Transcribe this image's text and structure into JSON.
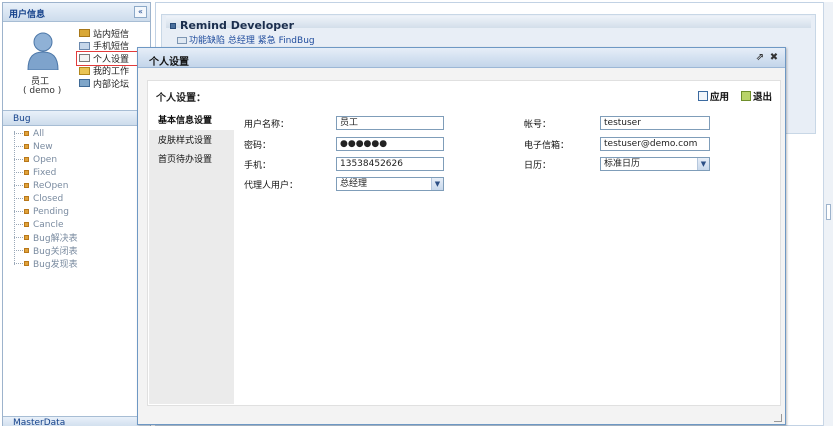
{
  "sidebar": {
    "title": "用户信息",
    "collapse_symbol": "«",
    "user_name": "员工",
    "user_role": "( demo )",
    "menu": [
      {
        "label": "站内短信",
        "icon": "mail-icon"
      },
      {
        "label": "手机短信",
        "icon": "phone-icon"
      },
      {
        "label": "个人设置",
        "icon": "edit-icon"
      },
      {
        "label": "我的工作",
        "icon": "folder-icon"
      },
      {
        "label": "内部论坛",
        "icon": "home-icon"
      }
    ],
    "bug_title": "Bug",
    "bug_items": [
      "All",
      "New",
      "Open",
      "Fixed",
      "ReOpen",
      "Closed",
      "Pending",
      "Cancle",
      "Bug解决表",
      "Bug关闭表",
      "Bug发现表"
    ],
    "masterdata_title": "MasterData"
  },
  "remind": {
    "title": "Remind Developer",
    "line": "功能缺陷 总经理 紧急 FindBug"
  },
  "dialog": {
    "title": "个人设置",
    "pin_symbol": "⇗",
    "close_symbol": "✖",
    "header": "个人设置：",
    "apply_label": "应用",
    "exit_label": "退出",
    "tabs": [
      "基本信息设置",
      "皮肤样式设置",
      "首页待办设置"
    ],
    "form": {
      "username_label": "用户名称：",
      "username_value": "员工",
      "password_label": "密码：",
      "password_value": "●●●●●●",
      "mobile_label": "手机：",
      "mobile_value": "13538452626",
      "proxy_label": "代理人用户：",
      "proxy_value": "总经理",
      "account_label": "帐号：",
      "account_value": "testuser",
      "email_label": "电子信箱：",
      "email_value": "testuser@demo.com",
      "calendar_label": "日历：",
      "calendar_value": "标准日历"
    }
  },
  "colors": {
    "accent": "#15428b",
    "highlight": "#e23b3b"
  }
}
